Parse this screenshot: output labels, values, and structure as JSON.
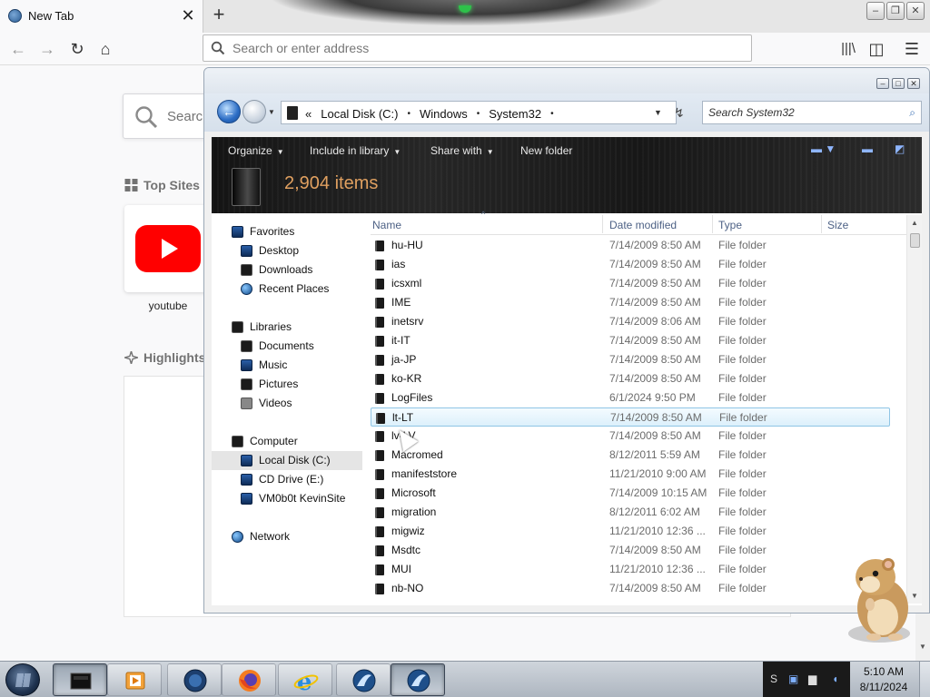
{
  "browser": {
    "tab_title": "New Tab",
    "tab_close": "✕",
    "new_tab": "+",
    "address_placeholder": "Search or enter address"
  },
  "newtab": {
    "search_placeholder": "Search",
    "top_sites_heading": "Top Sites",
    "top_sites": [
      {
        "label": "youtube"
      }
    ],
    "highlights_heading": "Highlights"
  },
  "explorer": {
    "breadcrumbs": [
      "Local Disk (C:)",
      "Windows",
      "System32"
    ],
    "breadcrumb_sep": "•",
    "breadcrumb_prefix": "«",
    "search_placeholder": "Search System32",
    "toolbar": {
      "organize": "Organize",
      "include": "Include in library",
      "share": "Share with",
      "new_folder": "New folder"
    },
    "item_count": "2,904 items",
    "nav": {
      "favorites": "Favorites",
      "desktop": "Desktop",
      "downloads": "Downloads",
      "recent": "Recent Places",
      "libraries": "Libraries",
      "documents": "Documents",
      "music": "Music",
      "pictures": "Pictures",
      "videos": "Videos",
      "computer": "Computer",
      "local_disk": "Local Disk (C:)",
      "cd_drive": "CD Drive (E:)",
      "vm_share": "VM0b0t KevinSite",
      "network": "Network"
    },
    "columns": {
      "name": "Name",
      "date": "Date modified",
      "type": "Type",
      "size": "Size"
    },
    "files": [
      {
        "name": "hu-HU",
        "date": "7/14/2009 8:50 AM",
        "type": "File folder"
      },
      {
        "name": "ias",
        "date": "7/14/2009 8:50 AM",
        "type": "File folder"
      },
      {
        "name": "icsxml",
        "date": "7/14/2009 8:50 AM",
        "type": "File folder"
      },
      {
        "name": "IME",
        "date": "7/14/2009 8:50 AM",
        "type": "File folder"
      },
      {
        "name": "inetsrv",
        "date": "7/14/2009 8:06 AM",
        "type": "File folder"
      },
      {
        "name": "it-IT",
        "date": "7/14/2009 8:50 AM",
        "type": "File folder"
      },
      {
        "name": "ja-JP",
        "date": "7/14/2009 8:50 AM",
        "type": "File folder"
      },
      {
        "name": "ko-KR",
        "date": "7/14/2009 8:50 AM",
        "type": "File folder"
      },
      {
        "name": "LogFiles",
        "date": "6/1/2024 9:50 PM",
        "type": "File folder"
      },
      {
        "name": "lt-LT",
        "date": "7/14/2009 8:50 AM",
        "type": "File folder"
      },
      {
        "name": "lv-LV",
        "date": "7/14/2009 8:50 AM",
        "type": "File folder"
      },
      {
        "name": "Macromed",
        "date": "8/12/2011 5:59 AM",
        "type": "File folder"
      },
      {
        "name": "manifeststore",
        "date": "11/21/2010 9:00 AM",
        "type": "File folder"
      },
      {
        "name": "Microsoft",
        "date": "7/14/2009 10:15 AM",
        "type": "File folder"
      },
      {
        "name": "migration",
        "date": "8/12/2011 6:02 AM",
        "type": "File folder"
      },
      {
        "name": "migwiz",
        "date": "11/21/2010 12:36 ...",
        "type": "File folder"
      },
      {
        "name": "Msdtc",
        "date": "7/14/2009 8:50 AM",
        "type": "File folder"
      },
      {
        "name": "MUI",
        "date": "11/21/2010 12:36 ...",
        "type": "File folder"
      },
      {
        "name": "nb-NO",
        "date": "7/14/2009 8:50 AM",
        "type": "File folder"
      }
    ]
  },
  "taskbar": {
    "time": "5:10 AM",
    "date": "8/11/2024"
  }
}
